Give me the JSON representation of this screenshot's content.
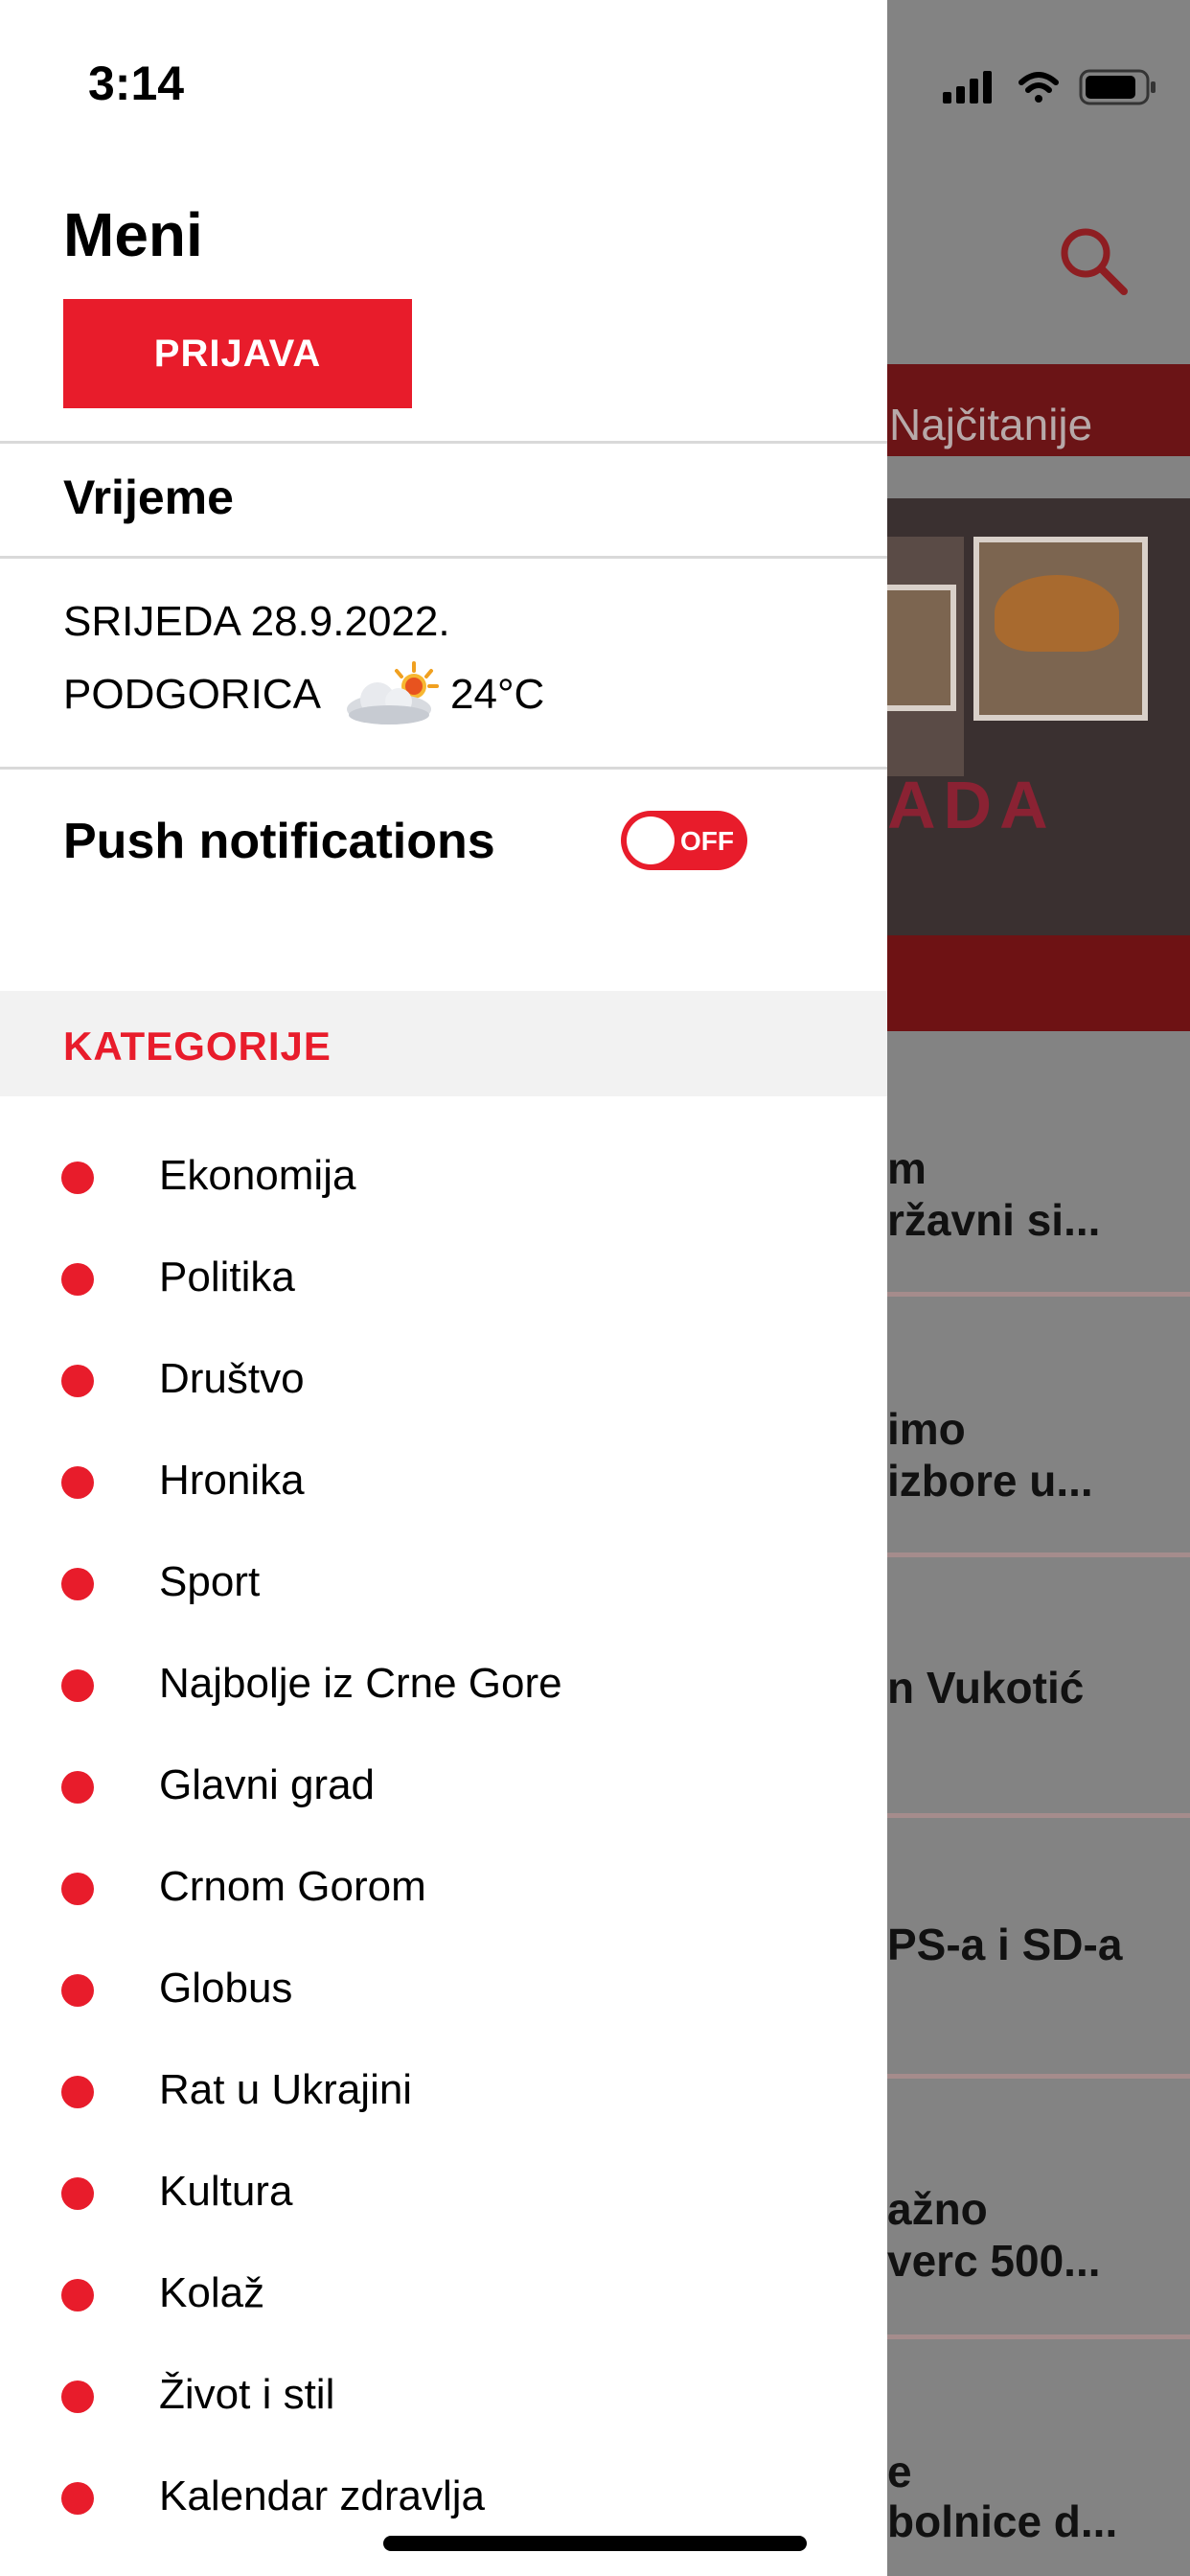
{
  "status_bar": {
    "time": "3:14"
  },
  "menu": {
    "title": "Meni",
    "login_label": "PRIJAVA",
    "weather": {
      "heading": "Vrijeme",
      "date": "SRIJEDA 28.9.2022.",
      "city": "PODGORICA",
      "temperature": "24°C",
      "icon": "partly-cloudy-sun-icon"
    },
    "push": {
      "label": "Push notifications",
      "state": "OFF"
    },
    "categories_title": "KATEGORIJE",
    "categories": [
      "Ekonomija",
      "Politika",
      "Društvo",
      "Hronika",
      "Sport",
      "Najbolje iz Crne Gore",
      "Glavni grad",
      "Crnom Gorom",
      "Globus",
      "Rat u Ukrajini",
      "Kultura",
      "Kolaž",
      "Život i stil",
      "Kalendar zdravlja"
    ]
  },
  "background": {
    "tab_label": "Najčitanije",
    "hero_brand": "ADA",
    "articles": [
      [
        "m",
        "ržavni si..."
      ],
      [
        "imo",
        "izbore u..."
      ],
      [
        "n Vukotić"
      ],
      [
        "PS-a i SD-a"
      ],
      [
        "ažno",
        "verc 500..."
      ],
      [
        "e",
        "bolnice d..."
      ]
    ]
  },
  "colors": {
    "accent": "#e81c2b",
    "categories_bg": "#f2f2f2",
    "overlay": "#838383"
  }
}
